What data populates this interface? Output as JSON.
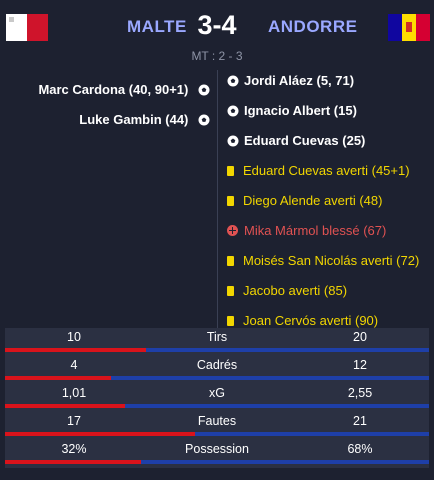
{
  "match": {
    "home_team": "MALTE",
    "away_team": "ANDORRE",
    "home_score": "3",
    "separator": "-",
    "away_score": "4",
    "halftime": "MT : 2 - 3",
    "colors": {
      "team_name": "#9aa8ff",
      "home_bar": "#d9131b",
      "away_bar": "#1e3fa8"
    }
  },
  "home_events": [
    {
      "text": "Marc Cardona (40, 90+1)",
      "icon": "soccer-ball-icon"
    },
    {
      "text": "Luke Gambin (44)",
      "icon": "soccer-ball-icon"
    }
  ],
  "away_events": [
    {
      "type": "goal",
      "icon": "soccer-ball-icon",
      "text": "Jordi Aláez (5, 71)"
    },
    {
      "type": "goal",
      "icon": "soccer-ball-icon",
      "text": "Ignacio Albert (15)"
    },
    {
      "type": "goal",
      "icon": "soccer-ball-icon",
      "text": "Eduard Cuevas (25)"
    },
    {
      "type": "card",
      "icon": "yellow-card-icon",
      "text": "Eduard Cuevas averti (45+1)"
    },
    {
      "type": "card",
      "icon": "yellow-card-icon",
      "text": "Diego Alende averti (48)"
    },
    {
      "type": "injury",
      "icon": "injury-icon",
      "text": "Mika Mármol blessé (67)"
    },
    {
      "type": "card",
      "icon": "yellow-card-icon",
      "text": "Moisés San Nicolás averti (72)"
    },
    {
      "type": "card",
      "icon": "yellow-card-icon",
      "text": "Jacobo averti (85)"
    },
    {
      "type": "card",
      "icon": "yellow-card-icon",
      "text": "Joan Cervós averti (90)"
    }
  ],
  "stats": [
    {
      "label": "Tirs",
      "home": "10",
      "away": "20",
      "home_fraction": 0.333
    },
    {
      "label": "Cadrés",
      "home": "4",
      "away": "12",
      "home_fraction": 0.25
    },
    {
      "label": "xG",
      "home": "1,01",
      "away": "2,55",
      "home_fraction": 0.284
    },
    {
      "label": "Fautes",
      "home": "17",
      "away": "21",
      "home_fraction": 0.447
    },
    {
      "label": "Possession",
      "home": "32%",
      "away": "68%",
      "home_fraction": 0.32
    }
  ]
}
